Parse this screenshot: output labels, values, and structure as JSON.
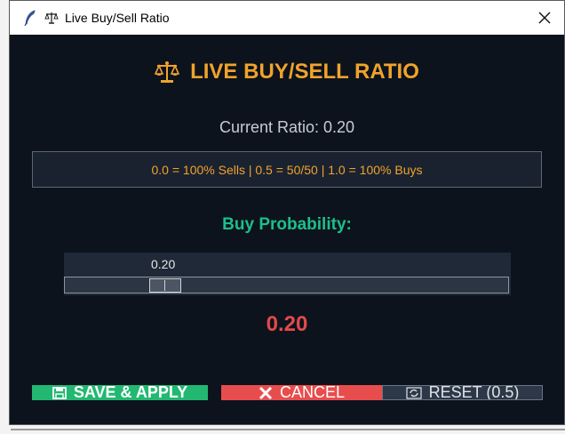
{
  "window": {
    "title": "Live Buy/Sell Ratio",
    "close_symbol": "✕"
  },
  "main": {
    "heading": "LIVE BUY/SELL RATIO",
    "current_ratio": "Current Ratio: 0.20",
    "info_text": "0.0 = 100% Sells | 0.5 = 50/50 | 1.0 = 100% Buys",
    "buy_probability_label": "Buy Probability:",
    "big_value": "0.20"
  },
  "slider": {
    "value_label": "0.20",
    "value": 0.2,
    "min": 0.0,
    "max": 1.0
  },
  "buttons": {
    "save_label": "SAVE & APPLY",
    "cancel_label": "CANCEL",
    "reset_label": "RESET (0.5)"
  },
  "icons": {
    "titlebar_app": "feather-icon",
    "titlebar_scale": "scale-icon",
    "heading": "scale-icon",
    "save": "floppy-disk-icon",
    "cancel": "x-icon",
    "reset": "refresh-icon"
  },
  "colors": {
    "background": "#0d131d",
    "accent_orange": "#f0a32b",
    "accent_green": "#1dbf8a",
    "value_red": "#e24a4a",
    "save_button": "#22b872",
    "cancel_button": "#e84d4d",
    "reset_button": "#2c3848"
  }
}
